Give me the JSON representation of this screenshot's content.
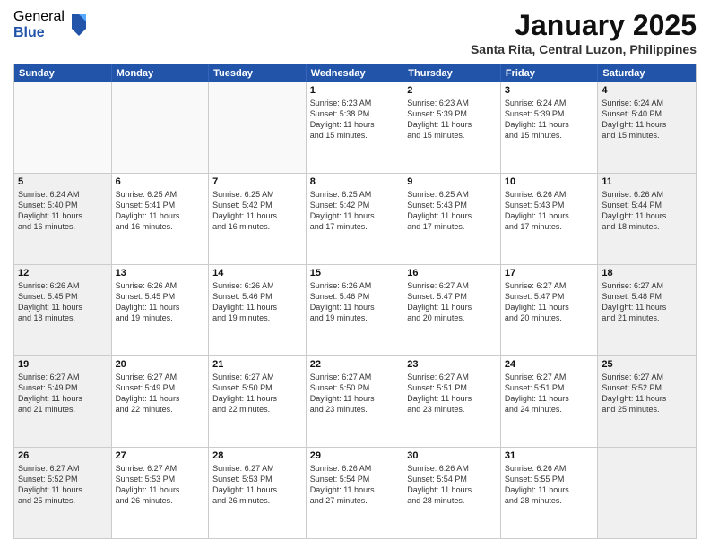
{
  "logo": {
    "general": "General",
    "blue": "Blue"
  },
  "header": {
    "title": "January 2025",
    "subtitle": "Santa Rita, Central Luzon, Philippines"
  },
  "weekdays": [
    "Sunday",
    "Monday",
    "Tuesday",
    "Wednesday",
    "Thursday",
    "Friday",
    "Saturday"
  ],
  "rows": [
    [
      {
        "day": "",
        "info": "",
        "empty": true
      },
      {
        "day": "",
        "info": "",
        "empty": true
      },
      {
        "day": "",
        "info": "",
        "empty": true
      },
      {
        "day": "1",
        "info": "Sunrise: 6:23 AM\nSunset: 5:38 PM\nDaylight: 11 hours\nand 15 minutes.",
        "empty": false
      },
      {
        "day": "2",
        "info": "Sunrise: 6:23 AM\nSunset: 5:39 PM\nDaylight: 11 hours\nand 15 minutes.",
        "empty": false
      },
      {
        "day": "3",
        "info": "Sunrise: 6:24 AM\nSunset: 5:39 PM\nDaylight: 11 hours\nand 15 minutes.",
        "empty": false
      },
      {
        "day": "4",
        "info": "Sunrise: 6:24 AM\nSunset: 5:40 PM\nDaylight: 11 hours\nand 15 minutes.",
        "empty": false,
        "shaded": true
      }
    ],
    [
      {
        "day": "5",
        "info": "Sunrise: 6:24 AM\nSunset: 5:40 PM\nDaylight: 11 hours\nand 16 minutes.",
        "empty": false,
        "shaded": true
      },
      {
        "day": "6",
        "info": "Sunrise: 6:25 AM\nSunset: 5:41 PM\nDaylight: 11 hours\nand 16 minutes.",
        "empty": false
      },
      {
        "day": "7",
        "info": "Sunrise: 6:25 AM\nSunset: 5:42 PM\nDaylight: 11 hours\nand 16 minutes.",
        "empty": false
      },
      {
        "day": "8",
        "info": "Sunrise: 6:25 AM\nSunset: 5:42 PM\nDaylight: 11 hours\nand 17 minutes.",
        "empty": false
      },
      {
        "day": "9",
        "info": "Sunrise: 6:25 AM\nSunset: 5:43 PM\nDaylight: 11 hours\nand 17 minutes.",
        "empty": false
      },
      {
        "day": "10",
        "info": "Sunrise: 6:26 AM\nSunset: 5:43 PM\nDaylight: 11 hours\nand 17 minutes.",
        "empty": false
      },
      {
        "day": "11",
        "info": "Sunrise: 6:26 AM\nSunset: 5:44 PM\nDaylight: 11 hours\nand 18 minutes.",
        "empty": false,
        "shaded": true
      }
    ],
    [
      {
        "day": "12",
        "info": "Sunrise: 6:26 AM\nSunset: 5:45 PM\nDaylight: 11 hours\nand 18 minutes.",
        "empty": false,
        "shaded": true
      },
      {
        "day": "13",
        "info": "Sunrise: 6:26 AM\nSunset: 5:45 PM\nDaylight: 11 hours\nand 19 minutes.",
        "empty": false
      },
      {
        "day": "14",
        "info": "Sunrise: 6:26 AM\nSunset: 5:46 PM\nDaylight: 11 hours\nand 19 minutes.",
        "empty": false
      },
      {
        "day": "15",
        "info": "Sunrise: 6:26 AM\nSunset: 5:46 PM\nDaylight: 11 hours\nand 19 minutes.",
        "empty": false
      },
      {
        "day": "16",
        "info": "Sunrise: 6:27 AM\nSunset: 5:47 PM\nDaylight: 11 hours\nand 20 minutes.",
        "empty": false
      },
      {
        "day": "17",
        "info": "Sunrise: 6:27 AM\nSunset: 5:47 PM\nDaylight: 11 hours\nand 20 minutes.",
        "empty": false
      },
      {
        "day": "18",
        "info": "Sunrise: 6:27 AM\nSunset: 5:48 PM\nDaylight: 11 hours\nand 21 minutes.",
        "empty": false,
        "shaded": true
      }
    ],
    [
      {
        "day": "19",
        "info": "Sunrise: 6:27 AM\nSunset: 5:49 PM\nDaylight: 11 hours\nand 21 minutes.",
        "empty": false,
        "shaded": true
      },
      {
        "day": "20",
        "info": "Sunrise: 6:27 AM\nSunset: 5:49 PM\nDaylight: 11 hours\nand 22 minutes.",
        "empty": false
      },
      {
        "day": "21",
        "info": "Sunrise: 6:27 AM\nSunset: 5:50 PM\nDaylight: 11 hours\nand 22 minutes.",
        "empty": false
      },
      {
        "day": "22",
        "info": "Sunrise: 6:27 AM\nSunset: 5:50 PM\nDaylight: 11 hours\nand 23 minutes.",
        "empty": false
      },
      {
        "day": "23",
        "info": "Sunrise: 6:27 AM\nSunset: 5:51 PM\nDaylight: 11 hours\nand 23 minutes.",
        "empty": false
      },
      {
        "day": "24",
        "info": "Sunrise: 6:27 AM\nSunset: 5:51 PM\nDaylight: 11 hours\nand 24 minutes.",
        "empty": false
      },
      {
        "day": "25",
        "info": "Sunrise: 6:27 AM\nSunset: 5:52 PM\nDaylight: 11 hours\nand 25 minutes.",
        "empty": false,
        "shaded": true
      }
    ],
    [
      {
        "day": "26",
        "info": "Sunrise: 6:27 AM\nSunset: 5:52 PM\nDaylight: 11 hours\nand 25 minutes.",
        "empty": false,
        "shaded": true
      },
      {
        "day": "27",
        "info": "Sunrise: 6:27 AM\nSunset: 5:53 PM\nDaylight: 11 hours\nand 26 minutes.",
        "empty": false
      },
      {
        "day": "28",
        "info": "Sunrise: 6:27 AM\nSunset: 5:53 PM\nDaylight: 11 hours\nand 26 minutes.",
        "empty": false
      },
      {
        "day": "29",
        "info": "Sunrise: 6:26 AM\nSunset: 5:54 PM\nDaylight: 11 hours\nand 27 minutes.",
        "empty": false
      },
      {
        "day": "30",
        "info": "Sunrise: 6:26 AM\nSunset: 5:54 PM\nDaylight: 11 hours\nand 28 minutes.",
        "empty": false
      },
      {
        "day": "31",
        "info": "Sunrise: 6:26 AM\nSunset: 5:55 PM\nDaylight: 11 hours\nand 28 minutes.",
        "empty": false
      },
      {
        "day": "",
        "info": "",
        "empty": true,
        "shaded": true
      }
    ]
  ]
}
